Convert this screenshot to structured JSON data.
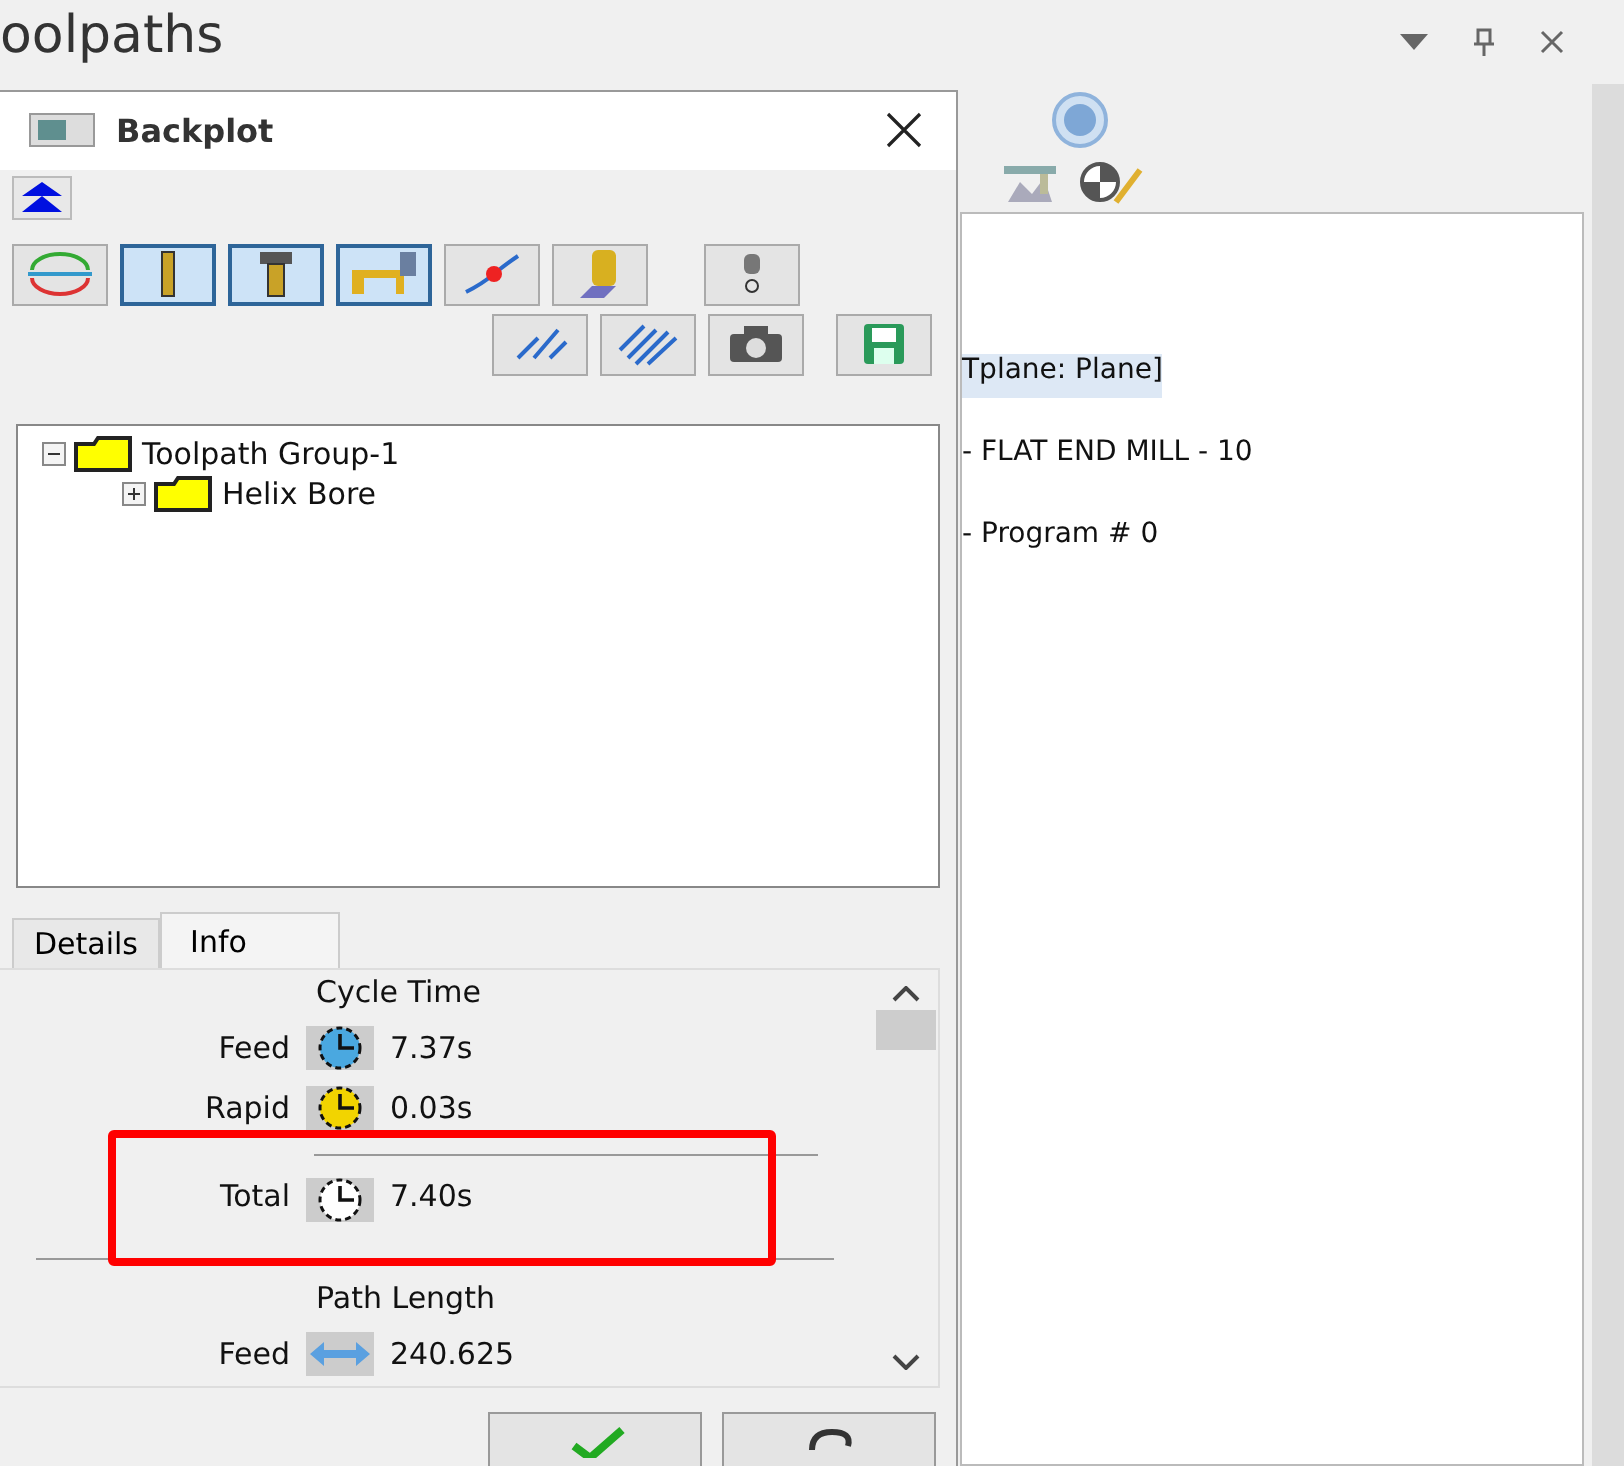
{
  "panel": {
    "title": "oolpaths",
    "lines": [
      {
        "text": "Tplane: Plane]",
        "selected": true
      },
      {
        "text": "- FLAT END MILL - 10",
        "selected": false
      },
      {
        "text": "- Program # 0",
        "selected": false
      }
    ]
  },
  "dialog": {
    "title": "Backplot",
    "toolbar_row_1": [
      {
        "selected": false
      },
      {
        "selected": true
      },
      {
        "selected": true
      },
      {
        "selected": true
      },
      {
        "selected": false
      },
      {
        "selected": false
      },
      {
        "selected": false
      }
    ],
    "toolbar_row_2": [
      {
        "selected": false
      },
      {
        "selected": false
      },
      {
        "selected": false
      },
      {
        "selected": false
      }
    ],
    "tree": [
      {
        "label": "Toolpath Group-1",
        "expanded": true,
        "children": [
          {
            "label": "Helix Bore",
            "expanded": false
          }
        ]
      }
    ],
    "tabs": [
      {
        "label": "Details",
        "selected": false
      },
      {
        "label": "Info",
        "selected": true
      }
    ],
    "info": [
      {
        "kind": "heading",
        "text": "Cycle Time"
      },
      {
        "kind": "clock",
        "label": "Feed",
        "value": "7.37s",
        "color": "#4aa8e0",
        "highlighted": false
      },
      {
        "kind": "clock",
        "label": "Rapid",
        "value": "0.03s",
        "color": "#f2d400",
        "highlighted": false
      },
      {
        "kind": "clock",
        "label": "Total",
        "value": "7.40s",
        "color": "#ffffff",
        "highlighted": true
      },
      {
        "kind": "heading",
        "text": "Path Length"
      },
      {
        "kind": "arrow",
        "label": "Feed",
        "value": "240.625",
        "highlighted": false
      }
    ]
  }
}
